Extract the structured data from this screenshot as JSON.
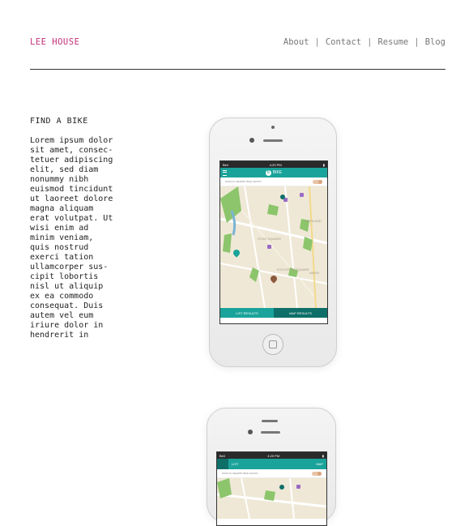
{
  "header": {
    "brand": "LEE HOUSE",
    "nav": [
      "About",
      "Contact",
      "Resume",
      "Blog"
    ],
    "separator": "|"
  },
  "content": {
    "heading": "FIND A BIKE",
    "body": "Lorem ipsum dolor\nsit amet, consec-\ntetuer adipiscing\nelit, sed diam\nnonummy nibh\neuismod tincidunt\nut laoreet dolore\nmagna aliquam\nerat volutpat. Ut\nwisi enim ad\nminim veniam,\nquis nostrud\nexerci tation\nullamcorper sus-\ncipit lobortis\nnisl ut aliquip\nex ea commodo\nconsequat. Duis\nautem vel eum\niriure dolor in\nhendrerit in"
  },
  "phone1": {
    "carrier": "Bell",
    "time": "4:20 PM",
    "app_title": "BIKE",
    "logo_letter": "B",
    "toggle_label": "DISPLAY NEARBY BIKE SHOPS",
    "tab_list": "LIST RESULTS",
    "tab_map": "MAP RESULTS",
    "map_labels": [
      "HYDE SQUARE",
      "EGLESTON SQUARE",
      "HIGHLAND",
      "WASH"
    ]
  },
  "phone2": {
    "carrier": "Bell",
    "time": "4:20 PM",
    "tab_list": "LIST",
    "tab_map": "MAP",
    "toggle_label": "DISPLAY NEARBY BIKE SHOPS"
  },
  "colors": {
    "brand": "#c4307a",
    "teal": "#1aa39a",
    "teal_dark": "#0e6f68",
    "map_bg": "#efe8d6",
    "park": "#8cc56b"
  }
}
